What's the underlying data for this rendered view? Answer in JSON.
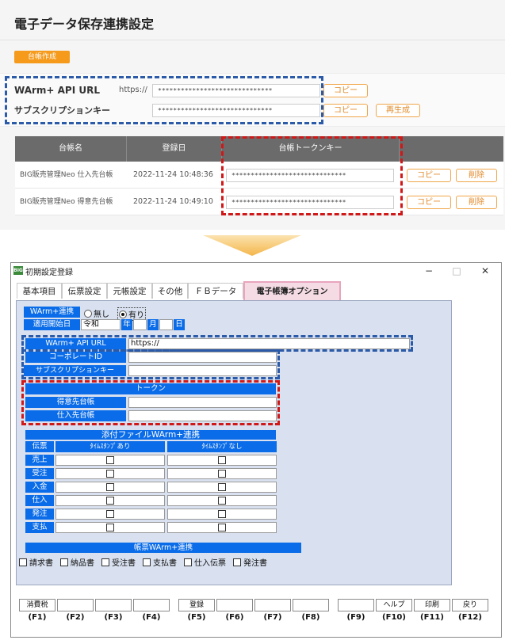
{
  "web": {
    "title": "電子データ保存連携設定",
    "create_button": "台帳作成",
    "api_url_label": "WArm+ API URL",
    "api_url_prefix": "https://",
    "api_url_value": "******************************",
    "subscription_label": "サブスクリプションキー",
    "subscription_value": "******************************",
    "copy_label": "コピー",
    "regenerate_label": "再生成",
    "table": {
      "headers": [
        "台帳名",
        "登録日",
        "台帳トークンキー",
        ""
      ],
      "rows": [
        {
          "name": "BIG販売管理Neo 仕入先台帳",
          "date": "2022-11-24 10:48:36",
          "token": "******************************",
          "copy": "コピー",
          "delete": "削除"
        },
        {
          "name": "BIG販売管理Neo 得意先台帳",
          "date": "2022-11-24 10:49:10",
          "token": "******************************",
          "copy": "コピー",
          "delete": "削除"
        }
      ]
    }
  },
  "window": {
    "icon_text": "BIG",
    "title": "初期設定登録",
    "controls": {
      "minimize": "−",
      "maximize": "□",
      "close": "✕"
    },
    "tabs": [
      "基本項目",
      "伝票設定",
      "元帳設定",
      "その他",
      "ＦＢデータ",
      "電子帳簿オプション"
    ],
    "warm_link_label": "WArm+連携",
    "radio_none": "無し",
    "radio_yes": "有り",
    "start_date_label": "適用開始日",
    "era_value": "令和",
    "year_label": "年",
    "month_label": "月",
    "day_label": "日",
    "api_url_label": "WArm+ API URL",
    "api_url_value": "https://",
    "corporate_id_label": "コーポレートID",
    "subscription_label": "サブスクリプションキー",
    "token_header": "トークン",
    "customer_ledger_label": "得意先台帳",
    "supplier_ledger_label": "仕入先台帳",
    "attach_header": "添付ファイルWArm+連携",
    "slip_col": "伝票",
    "ts_yes_col": "ﾀｲﾑｽﾀﾝﾌﾟあり",
    "ts_no_col": "ﾀｲﾑｽﾀﾝﾌﾟなし",
    "slip_rows": [
      "売上",
      "受注",
      "入金",
      "仕入",
      "発注",
      "支払"
    ],
    "form_header": "帳票WArm+連携",
    "form_checks": [
      "請求書",
      "納品書",
      "受注書",
      "支払書",
      "仕入伝票",
      "発注書"
    ]
  },
  "fkeys": [
    {
      "label": "消費税",
      "key": "(F1)"
    },
    {
      "label": "",
      "key": "(F2)"
    },
    {
      "label": "",
      "key": "(F3)"
    },
    {
      "label": "",
      "key": "(F4)"
    },
    {
      "label": "登録",
      "key": "(F5)"
    },
    {
      "label": "",
      "key": "(F6)"
    },
    {
      "label": "",
      "key": "(F7)"
    },
    {
      "label": "",
      "key": "(F8)"
    },
    {
      "label": "",
      "key": "(F9)"
    },
    {
      "label": "ヘルプ",
      "key": "(F10)"
    },
    {
      "label": "印刷",
      "key": "(F11)"
    },
    {
      "label": "戻り",
      "key": "(F12)"
    }
  ],
  "colors": {
    "accent_orange": "#f59a1b",
    "field_blue": "#0a6ce8",
    "highlight_red": "#d01818",
    "highlight_blue": "#2a5aa8",
    "tab_pink": "#f4dbe4"
  }
}
